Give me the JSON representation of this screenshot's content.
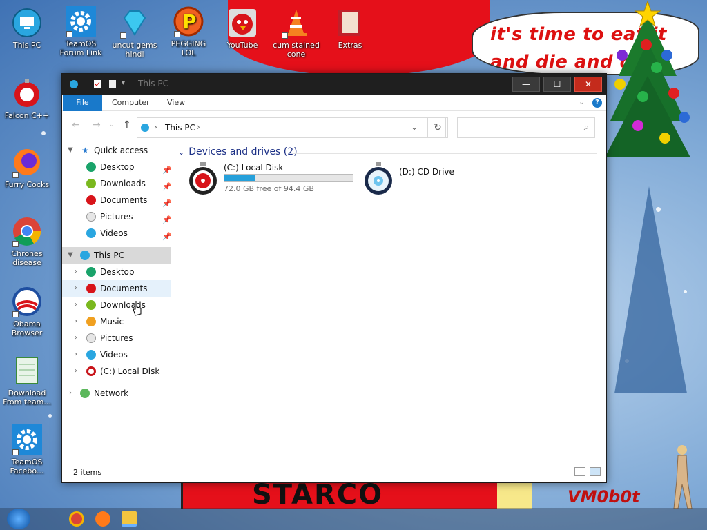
{
  "desktop": {
    "icons": [
      {
        "label": "This PC"
      },
      {
        "label": "TeamOS Forum Link"
      },
      {
        "label": "uncut gems hindi"
      },
      {
        "label": "PEGGING LOL"
      },
      {
        "label": "YouTube"
      },
      {
        "label": "cum stained cone"
      },
      {
        "label": "Extras"
      },
      {
        "label": "Falcon C++"
      },
      {
        "label": "Furry Cocks"
      },
      {
        "label": "Chrones disease"
      },
      {
        "label": "Obama Browser"
      },
      {
        "label": "Download From team..."
      },
      {
        "label": "TeamOS Facebo..."
      }
    ],
    "speech_line1": "it's time to eat it",
    "speech_line2": "and die and d",
    "banner_text": "STARCO",
    "signature": "VM0b0t"
  },
  "window": {
    "title": "This PC",
    "controls": {
      "minimize": "—",
      "maximize": "☐",
      "close": "✕"
    },
    "ribbon": {
      "tabs": [
        "File",
        "Computer",
        "View"
      ]
    },
    "address": {
      "path": "This PC",
      "separator": "›"
    },
    "search": {
      "placeholder": ""
    },
    "nav": {
      "quick_access": {
        "label": "Quick access",
        "items": [
          "Desktop",
          "Downloads",
          "Documents",
          "Pictures",
          "Videos"
        ]
      },
      "this_pc": {
        "label": "This PC",
        "items": [
          "Desktop",
          "Documents",
          "Downloads",
          "Music",
          "Pictures",
          "Videos",
          "(C:) Local Disk"
        ]
      },
      "network": {
        "label": "Network"
      }
    },
    "content": {
      "group_header": "Devices and drives (2)",
      "drives": [
        {
          "name": "(C:) Local Disk",
          "free_text": "72.0 GB free of 94.4 GB",
          "used_fraction": 0.237
        },
        {
          "name": "(D:) CD Drive"
        }
      ]
    },
    "status": {
      "item_count": "2 items"
    }
  },
  "colors": {
    "accent": "#1979ca",
    "drive_bar": "#26a0da",
    "title_bar": "#1f1f1f",
    "close_button": "#c42b1c"
  }
}
